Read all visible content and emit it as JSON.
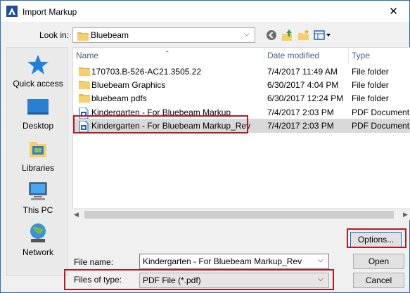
{
  "window": {
    "title": "Import Markup",
    "close_glyph": "✕"
  },
  "lookin": {
    "label": "Look in:",
    "value": "Bluebeam"
  },
  "toolbar": {
    "icons": [
      "back-icon",
      "up-folder-icon",
      "new-folder-icon",
      "view-menu-icon"
    ]
  },
  "places": [
    {
      "label": "Quick access",
      "icon": "star-icon"
    },
    {
      "label": "Desktop",
      "icon": "desktop-icon"
    },
    {
      "label": "Libraries",
      "icon": "libraries-icon"
    },
    {
      "label": "This PC",
      "icon": "computer-icon"
    },
    {
      "label": "Network",
      "icon": "network-icon"
    }
  ],
  "columns": {
    "name": "Name",
    "date": "Date modified",
    "type": "Type"
  },
  "files": [
    {
      "name": "170703.B-526-AC21.3505.22",
      "date": "7/4/2017 11:49 AM",
      "type": "File folder",
      "icon": "folder-icon"
    },
    {
      "name": "Bluebeam Graphics",
      "date": "6/30/2017 4:04 PM",
      "type": "File folder",
      "icon": "folder-icon"
    },
    {
      "name": "bluebeam pdfs",
      "date": "6/30/2017 12:24 PM",
      "type": "File folder",
      "icon": "folder-icon"
    },
    {
      "name": "Kindergarten - For Bluebeam Markup",
      "date": "7/4/2017 2:03 PM",
      "type": "PDF Document",
      "icon": "pdf-icon"
    },
    {
      "name": "Kindergarten - For Bluebeam Markup_Rev",
      "date": "7/4/2017 2:03 PM",
      "type": "PDF Document",
      "icon": "pdf-icon",
      "selected": true
    }
  ],
  "filename": {
    "label": "File name:",
    "value": "Kindergarten - For Bluebeam Markup_Rev"
  },
  "filetype": {
    "label": "Files of type:",
    "value": "PDF File (*.pdf)"
  },
  "buttons": {
    "options": "Options...",
    "open": "Open",
    "cancel": "Cancel"
  },
  "colors": {
    "highlight": "#b31b24",
    "selection": "#d9d9d9",
    "accent": "#0078d7"
  }
}
